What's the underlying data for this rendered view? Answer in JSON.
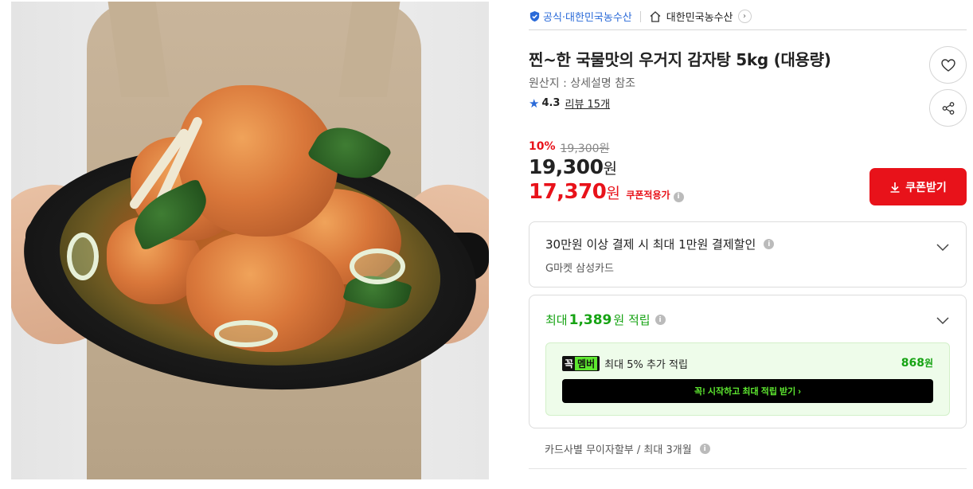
{
  "seller": {
    "official_label": "공식·대한민국농수산",
    "shop_name": "대한민국농수산",
    "shop_arrow": "›"
  },
  "product": {
    "title": "찐~한 국물맛의 우거지 감자탕 5kg (대용량)",
    "origin": "원산지 : 상세설명 참조",
    "rating": "4.3",
    "review_link": "리뷰 15개"
  },
  "price": {
    "discount_rate": "10%",
    "original_price": "19,300원",
    "price_number": "19,300",
    "price_unit": "원",
    "coupon_price_number": "17,370",
    "coupon_price_unit": "원",
    "coupon_label": "쿠폰적용가",
    "coupon_button": "쿠폰받기"
  },
  "card_benefit": {
    "headline": "30만원 이상 결제 시 최대 1만원 결제할인",
    "card_name": "G마켓 삼성카드"
  },
  "points": {
    "prefix": "최대",
    "amount": "1,389",
    "suffix": "원 적립",
    "member_logo_a": "꼭",
    "member_logo_b": "멤버",
    "member_text": "최대 5% 추가 적립",
    "member_amount": "868",
    "member_amount_unit": "원",
    "member_cta": "꼭! 시작하고 최대 적립 받기 ›"
  },
  "installment": {
    "text": "카드사별 무이자할부 / 최대 3개월"
  },
  "icons": {
    "info": "i",
    "star": "★"
  },
  "colors": {
    "accent_red": "#e8121a",
    "official_blue": "#2a6ad8",
    "points_green": "#16a313"
  }
}
